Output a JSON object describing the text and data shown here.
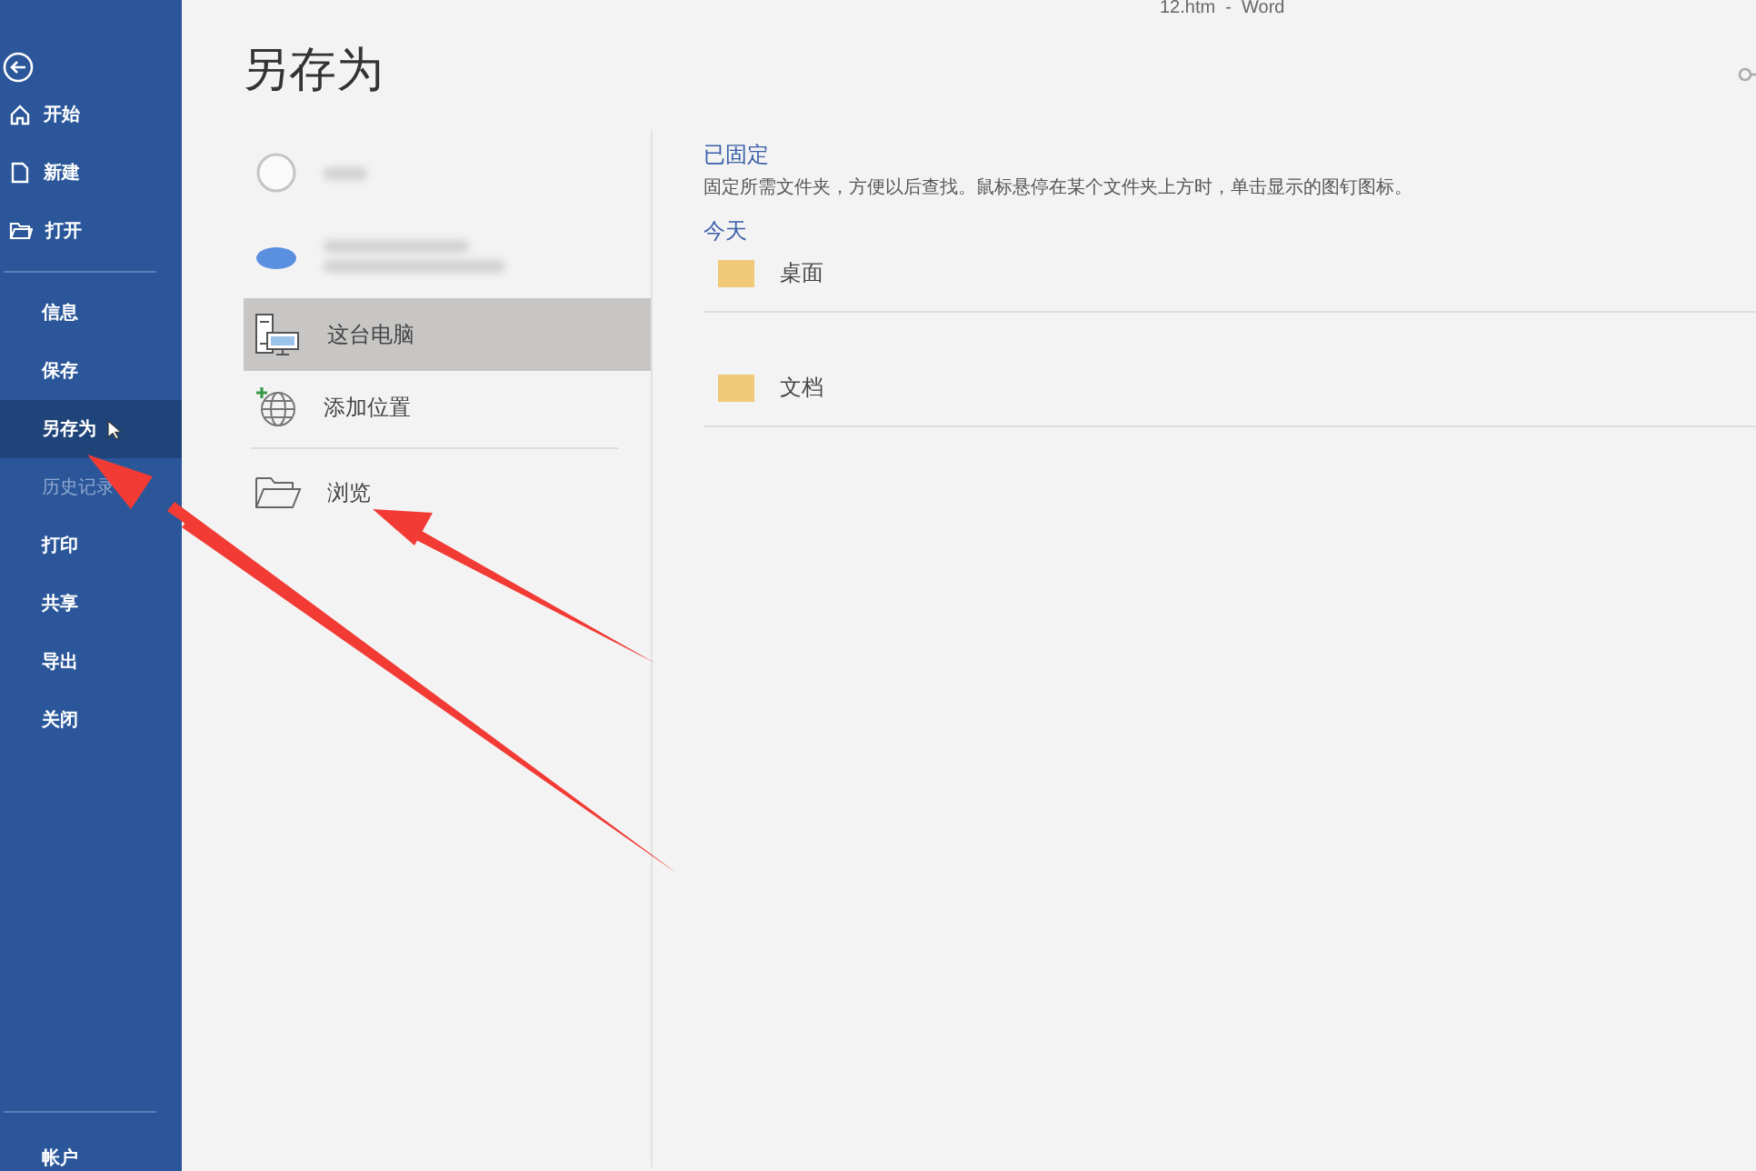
{
  "window": {
    "title": "12.htm  -  Word"
  },
  "sidebar": {
    "top_items": [
      {
        "label": "开始"
      },
      {
        "label": "新建"
      },
      {
        "label": "打开"
      }
    ],
    "items": [
      {
        "label": "信息",
        "selected": false,
        "disabled": false
      },
      {
        "label": "保存",
        "selected": false,
        "disabled": false
      },
      {
        "label": "另存为",
        "selected": true,
        "disabled": false
      },
      {
        "label": "历史记录",
        "selected": false,
        "disabled": true
      },
      {
        "label": "打印",
        "selected": false,
        "disabled": false
      },
      {
        "label": "共享",
        "selected": false,
        "disabled": false
      },
      {
        "label": "导出",
        "selected": false,
        "disabled": false
      },
      {
        "label": "关闭",
        "selected": false,
        "disabled": false
      }
    ],
    "bottom_items": [
      {
        "label": "帐户"
      }
    ]
  },
  "page_title": "另存为",
  "locations": [
    {
      "kind": "blurred",
      "selected": false
    },
    {
      "kind": "blurred-account",
      "selected": false
    },
    {
      "kind": "pc",
      "label": "这台电脑",
      "selected": true
    },
    {
      "kind": "add",
      "label": "添加位置",
      "selected": false
    },
    {
      "kind": "browse",
      "label": "浏览",
      "selected": false
    }
  ],
  "pinned": {
    "heading": "已固定",
    "description": "固定所需文件夹，方便以后查找。鼠标悬停在某个文件夹上方时，单击显示的图钉图标。"
  },
  "today": {
    "heading": "今天",
    "folders": [
      {
        "label": "桌面"
      },
      {
        "label": "文档"
      }
    ]
  }
}
